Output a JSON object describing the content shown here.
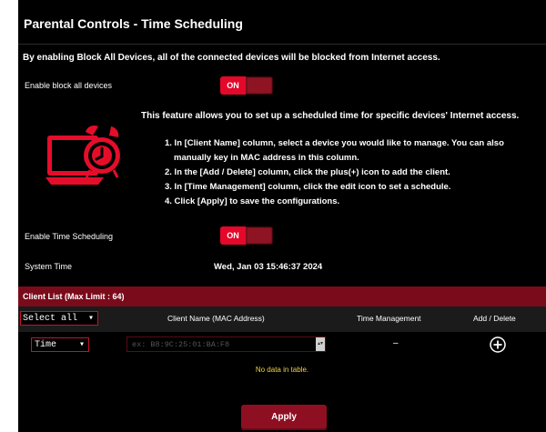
{
  "header": {
    "title": "Parental Controls - Time Scheduling"
  },
  "block_all": {
    "info": "By enabling Block All Devices, all of the connected devices will be blocked from Internet access.",
    "label": "Enable block all devices",
    "toggle_label": "ON"
  },
  "feature": {
    "intro": "This feature allows you to set up a scheduled time for specific devices' Internet access.",
    "steps": [
      "1. In [Client Name] column, select a device you would like to manage. You can also",
      "manually key in MAC address in this column.",
      "2. In the [Add / Delete] column, click the plus(+) icon to add the client.",
      "3. In [Time Management] column, click the edit icon to set a schedule.",
      "4. Click [Apply] to save the configurations."
    ]
  },
  "time_scheduling": {
    "label": "Enable Time Scheduling",
    "toggle_label": "ON"
  },
  "system_time": {
    "label": "System Time",
    "value": "Wed, Jan 03 15:46:37 2024"
  },
  "client_list": {
    "title": "Client List (Max Limit : 64)",
    "select_all": "Select all",
    "columns": [
      "Client Name (MAC Address)",
      "Time Management",
      "Add / Delete"
    ],
    "row": {
      "mode": "Time",
      "mac_placeholder": "ex: B8:9C:25:01:BA:F8",
      "time_mgmt": "–"
    },
    "empty_text": "No data in table."
  },
  "apply_label": "Apply",
  "colors": {
    "accent": "#e4082a",
    "header_bar": "#7a0b1b",
    "nodata": "#f7d23a"
  }
}
